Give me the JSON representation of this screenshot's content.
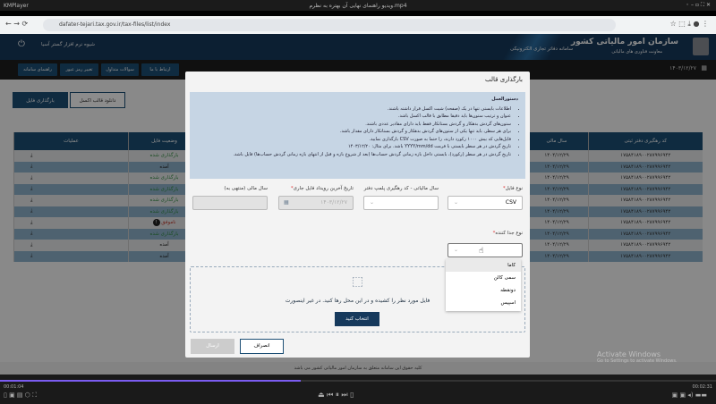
{
  "player": {
    "app": "KMPlayer",
    "title": "ویدیو راهنمای نهایی آن بهتره به نظرم.mp4",
    "elapsed": "00:01:04",
    "total": "00:02:31",
    "progress_percent": 42,
    "progress_color": "#7b5cf0"
  },
  "browser": {
    "url": "dafater-tejari.tax.gov.ir/tax-files/list/index"
  },
  "header": {
    "org": "سازمان امور مالیاتی کشور",
    "org_sub": "معاونت فناوری های مالیاتی",
    "system": "سامانه دفاتر تجاری الکترونیکی",
    "user": "شیوه نرم افزار گستر آسیا",
    "date": "۱۴۰۳/۱۲/۲۷"
  },
  "nav": [
    "ارتباط با ما",
    "سوالات متداول",
    "تغییر رمز عبور",
    "راهنمای سامانه"
  ],
  "page": {
    "upload_button": "بارگذاری فایل",
    "download_template": "دانلود قالب اکسل",
    "columns": [
      "کد رهگیری دفتر ثبتی",
      "سال مالی",
      "وضعیت فایل",
      "عملیات"
    ],
    "rows": [
      {
        "code": "۱۷۵۸۴۱۸۹۰۰۲۸۷۹۹۶۹۴۲",
        "year": "۱۴۰۴/۱۲/۲۹",
        "status": "بارگذاری شده",
        "ok": "green"
      },
      {
        "code": "۱۷۵۸۴۱۸۹۰۰۲۸۷۹۹۶۹۴۲",
        "year": "۱۴۰۴/۱۲/۲۹",
        "status": "آمده",
        "ok": "black"
      },
      {
        "code": "۱۷۵۸۴۱۸۹۰۰۲۸۷۹۹۶۹۴۲",
        "year": "۱۴۰۴/۱۲/۲۹",
        "status": "بارگذاری شده",
        "ok": "green"
      },
      {
        "code": "۱۷۵۸۴۱۸۹۰۰۲۸۷۹۹۶۹۴۲",
        "year": "۱۴۰۴/۱۲/۲۹",
        "status": "بارگذاری شده",
        "ok": "green"
      },
      {
        "code": "۱۷۵۸۴۱۸۹۰۰۲۸۷۹۹۶۹۴۲",
        "year": "۱۴۰۴/۱۲/۲۹",
        "status": "بارگذاری شده",
        "ok": "green"
      },
      {
        "code": "۱۷۵۸۴۱۸۹۰۰۲۸۷۹۹۶۹۴۲",
        "year": "۱۴۰۴/۱۲/۲۹",
        "status": "بارگذاری شده",
        "ok": "green"
      },
      {
        "code": "۱۷۵۸۴۱۸۹۰۰۲۸۷۹۹۶۹۴۲",
        "year": "۱۴۰۴/۱۲/۲۹",
        "status": "ناموفق",
        "ok": "red"
      },
      {
        "code": "۱۷۵۸۴۱۸۹۰۰۲۸۷۹۹۶۹۴۲",
        "year": "۱۴۰۴/۱۲/۲۹",
        "status": "بارگذاری شده",
        "ok": "green"
      },
      {
        "code": "۱۷۵۸۴۱۸۹۰۰۲۸۷۹۹۶۹۴۲",
        "year": "۱۴۰۴/۱۲/۲۹",
        "status": "آمده",
        "ok": "black"
      },
      {
        "code": "۱۷۵۸۴۱۸۹۰۰۲۸۷۹۹۶۹۴۲",
        "year": "۱۴۰۴/۱۲/۲۹",
        "status": "آمده",
        "ok": "black"
      }
    ]
  },
  "footer": "کلیه حقوق این سامانه متعلق به سازمان امور مالیاتی کشور می باشد",
  "modal": {
    "title": "بارگذاری قالب",
    "instructions_title": "دستورالعمل",
    "instructions": [
      "اطلاعات بایستی تنها در یک (صفحه) شیت اکسل قرار داشته باشند.",
      "عنوان و ترتیب ستون‌ها باید دقیقا مطابق با قالب اکسل باشد.",
      "ستون‌های گردش بدهکار و گردش بستانکار فقط باید دارای مقادیر عددی باشند.",
      "برای هر سطر، باید تنها یکی از ستون‌های گردش بدهکار و گردش بستانکار دارای مقدار باشد.",
      "فایل‌هایی که بیش ۱۰۰۰ رکورد دارند، را حتما به صورت CSV بارگذاری نمایید.",
      "تاریخ گردش در هر سطر بایستی با فرمت YYYY/mm/dd باشد. برای مثال: ۱۴۰۳/۱۲/۲۰",
      "تاریخ گردش در هر سطر (رکورد)، بایستی داخل بازه زمانی گردش حساب‌ها (بعد از شروع بازه و قبل از انتهای بازه زمانی گردش حساب‌ها) فایل باشد."
    ],
    "file_type_label": "نوع فایل",
    "file_type_value": "CSV",
    "year_code_label": "سال مالیاتی - کد رهگیری پلمپ دفتر",
    "last_event_label": "تاریخ آخرین رویداد فایل جاری",
    "last_event_value": "۱۴۰۳/۱۲/۲۷",
    "fiscal_end_label": "سال مالی (منتهی به)",
    "separator_label": "نوع جدا کننده",
    "separator_options": [
      "کاما",
      "سمی کالن",
      "دونقطه",
      "اسپیس"
    ],
    "drop_text": "فایل مورد نظر را کشیده و در این محل رها کنید. در غیر اینصورت",
    "choose": "انتخاب کنید",
    "cancel": "انصراف",
    "send": "ارسال"
  },
  "watermark": {
    "line1": "Activate Windows",
    "line2": "Go to Settings to activate Windows."
  }
}
